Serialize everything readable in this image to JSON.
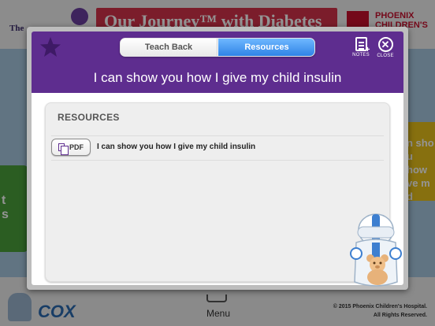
{
  "background": {
    "logo_left": "The",
    "banner_text": "Our Journey™ with Diabetes",
    "hospital_line1": "PHOENIX",
    "hospital_line2": "CHILDREN'S",
    "side_right_text": "n sho\nu how\nve m\nd insu",
    "side_left_text": "t\ns",
    "sponsor": "COX",
    "menu_label": "Menu",
    "copyright_line1": "© 2015 Phoenix Children's Hospital.",
    "copyright_line2": "All Rights Reserved."
  },
  "modal": {
    "favorite_icon": "star-icon",
    "tabs": [
      {
        "label": "Teach Back",
        "active": false
      },
      {
        "label": "Resources",
        "active": true
      }
    ],
    "notes_label": "NOTES",
    "close_label": "CLOSE",
    "title": "I can show you how I give my child insulin",
    "resources": {
      "heading": "RESOURCES",
      "items": [
        {
          "type_label": "PDF",
          "label": "I can show you how I give my child insulin"
        }
      ]
    }
  },
  "colors": {
    "header_purple": "#5e2d8f",
    "tab_active_blue": "#3a8ff0"
  }
}
